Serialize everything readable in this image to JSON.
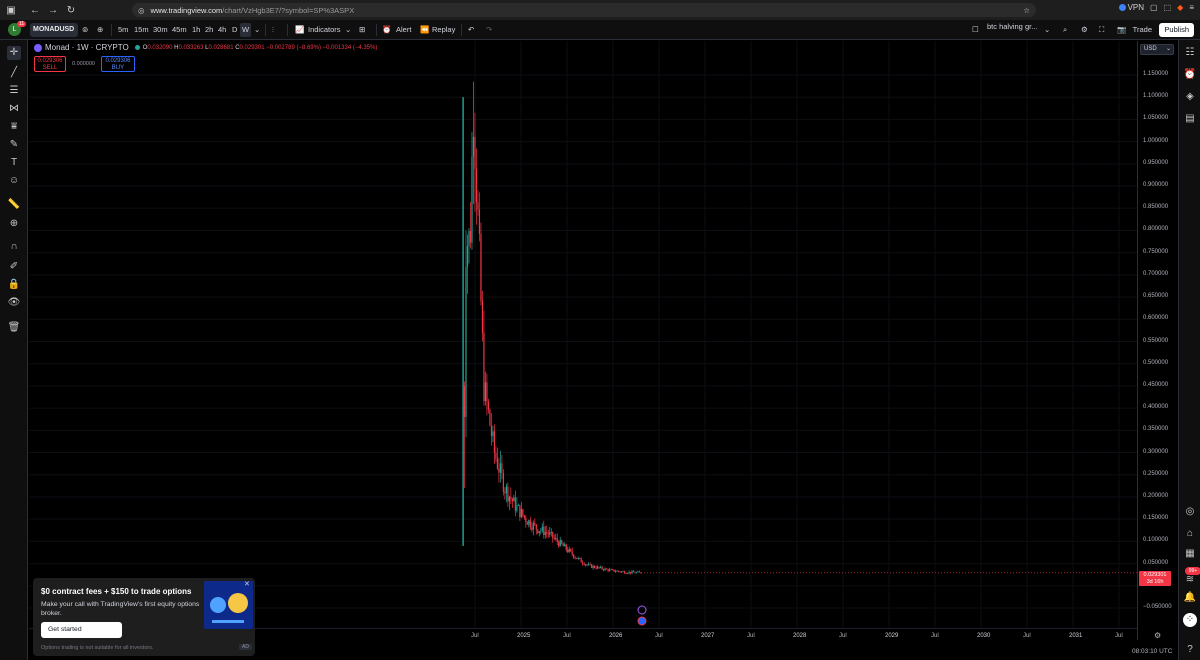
{
  "browser": {
    "url_host": "www.tradingview.com",
    "url_path": "/chart/VzHgb3E7/?symbol=SP%3ASPX",
    "vpn_label": "VPN"
  },
  "toolbar": {
    "avatar_letter": "L",
    "avatar_badge": "11",
    "symbol": "MONADUSD",
    "intervals": [
      "5m",
      "15m",
      "30m",
      "45m",
      "1h",
      "2h",
      "4h",
      "D",
      "W"
    ],
    "active_interval": "W",
    "indicators_label": "Indicators",
    "alert_label": "Alert",
    "replay_label": "Replay",
    "layout_name": "btc halving gr...",
    "trade_label": "Trade",
    "publish_label": "Publish"
  },
  "legend": {
    "title": "Monad · 1W · CRYPTO",
    "open_label": "O",
    "open": "0.032090",
    "high_label": "H",
    "high": "0.033263",
    "low_label": "L",
    "low": "0.028681",
    "close_label": "C",
    "close": "0.029301",
    "change": "−0.002789 (−8.69%)",
    "change2": "−0.001334 (−4.35%)",
    "sell_price": "0.029306",
    "sell_label": "SELL",
    "spread": "0.000000",
    "buy_price": "0.029306",
    "buy_label": "BUY"
  },
  "price_axis": {
    "currency": "USD",
    "labels": [
      "1.150000",
      "1.100000",
      "1.050000",
      "1.000000",
      "0.950000",
      "0.900000",
      "0.850000",
      "0.800000",
      "0.750000",
      "0.700000",
      "0.650000",
      "0.600000",
      "0.550000",
      "0.500000",
      "0.450000",
      "0.400000",
      "0.350000",
      "0.300000",
      "0.250000",
      "0.200000",
      "0.150000",
      "0.100000",
      "0.050000",
      "0.000000",
      "−0.050000"
    ],
    "current_price": "0.029301",
    "countdown": "3d 16h"
  },
  "time_axis": {
    "labels": [
      "Jul",
      "2025",
      "Jul",
      "2026",
      "Jul",
      "2027",
      "Jul",
      "2028",
      "Jul",
      "2029",
      "Jul",
      "2030",
      "Jul",
      "2031",
      "Jul"
    ],
    "year_labels": [
      "2025",
      "2026",
      "2027",
      "2028",
      "2029",
      "2030",
      "2031"
    ],
    "clock": "08:03:10 UTC"
  },
  "promo": {
    "title": "$0 contract fees + $150 to trade options",
    "body": "Make your call with TradingView's first equity options broker.",
    "button": "Get started",
    "footnote": "Options trading is not suitable for all investors.",
    "ad_label": "AD"
  },
  "colors": {
    "up": "#26a69a",
    "down": "#f23645",
    "background": "#000000",
    "accent": "#2962ff"
  },
  "chart_data": {
    "type": "candlestick",
    "timeframe": "1W",
    "ylim": [
      -0.05,
      1.15
    ],
    "series": [
      {
        "name": "Monad",
        "values": [
          0.09,
          1.1,
          0.45,
          0.3,
          0.22,
          0.18,
          0.15,
          0.13,
          0.12,
          0.1,
          0.08,
          0.06,
          0.045,
          0.04,
          0.035,
          0.032,
          0.03,
          0.029301
        ]
      }
    ],
    "last_value": 0.029301
  }
}
